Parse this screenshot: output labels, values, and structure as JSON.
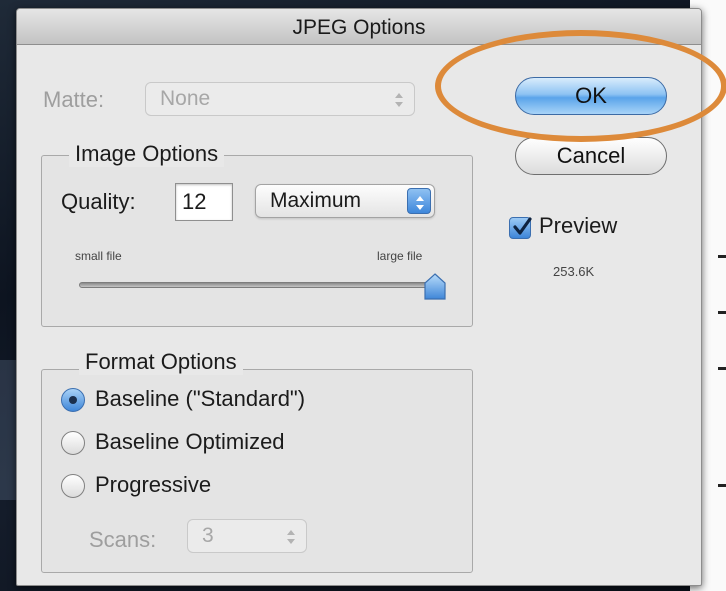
{
  "dialog": {
    "title": "JPEG Options",
    "matte_label": "Matte:",
    "matte_value": "None",
    "image_options": {
      "title": "Image Options",
      "quality_label": "Quality:",
      "quality_value": "12",
      "quality_preset": "Maximum",
      "small_file_label": "small file",
      "large_file_label": "large file",
      "slider_level_fraction": 1.0
    },
    "format_options": {
      "title": "Format Options",
      "options": [
        {
          "label": "Baseline (\"Standard\")",
          "selected": true
        },
        {
          "label": "Baseline Optimized",
          "selected": false
        },
        {
          "label": "Progressive",
          "selected": false
        }
      ],
      "scans_label": "Scans:",
      "scans_value": "3"
    },
    "buttons": {
      "ok": "OK",
      "cancel": "Cancel"
    },
    "preview": {
      "label": "Preview",
      "checked": true,
      "file_size": "253.6K"
    }
  },
  "colors": {
    "highlight_ring": "#dd8a3a",
    "accent_blue": "#3f86d8"
  },
  "icons": [
    "popup-arrows-icon",
    "checkmark-icon",
    "slider-thumb-icon"
  ]
}
